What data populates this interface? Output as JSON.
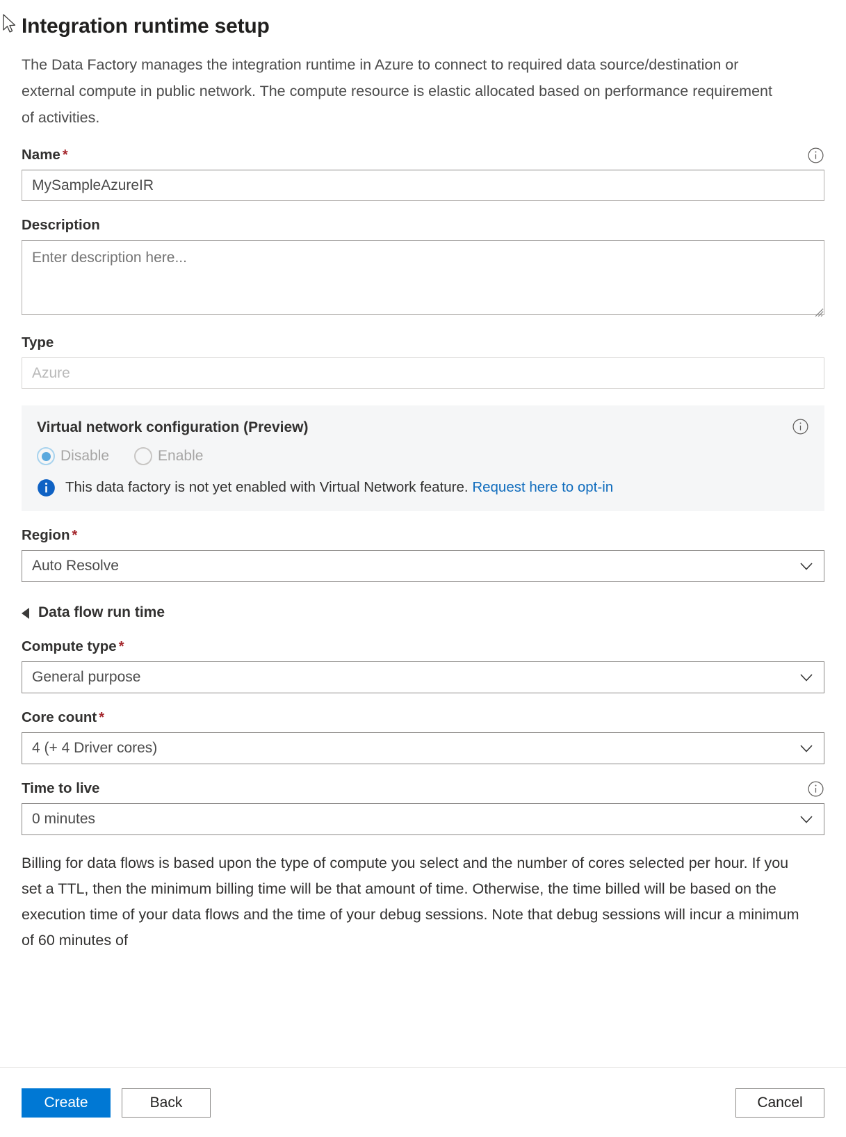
{
  "page": {
    "title": "Integration runtime setup",
    "intro": "The Data Factory manages the integration runtime in Azure to connect to required data source/destination or external compute in public network. The compute resource is elastic allocated based on performance requirement of activities."
  },
  "fields": {
    "name": {
      "label": "Name",
      "required": "*",
      "value": "MySampleAzureIR",
      "info_icon": "info-circle-icon"
    },
    "description": {
      "label": "Description",
      "placeholder": "Enter description here...",
      "value": ""
    },
    "type": {
      "label": "Type",
      "value": "Azure",
      "disabled": true
    },
    "region": {
      "label": "Region",
      "required": "*",
      "value": "Auto Resolve",
      "chevron_icon": "chevron-down-icon"
    },
    "compute_type": {
      "label": "Compute type",
      "required": "*",
      "value": "General purpose",
      "chevron_icon": "chevron-down-icon"
    },
    "core_count": {
      "label": "Core count",
      "required": "*",
      "value": "4 (+ 4 Driver cores)",
      "chevron_icon": "chevron-down-icon"
    },
    "time_to_live": {
      "label": "Time to live",
      "value": "0 minutes",
      "info_icon": "info-circle-icon",
      "chevron_icon": "chevron-down-icon"
    }
  },
  "vnet": {
    "title": "Virtual network configuration (Preview)",
    "info_icon": "info-circle-icon",
    "options": [
      {
        "label": "Disable",
        "selected": true
      },
      {
        "label": "Enable",
        "selected": false
      }
    ],
    "message": "This data factory is not yet enabled with Virtual Network feature.",
    "link_text": "Request here to opt-in",
    "message_icon": "info-filled-icon"
  },
  "dataflow_section": {
    "title": "Data flow run time",
    "expanded": true,
    "toggle_icon": "triangle-collapse-icon"
  },
  "billing_note": "Billing for data flows is based upon the type of compute you select and the number of cores selected per hour. If you set a TTL, then the minimum billing time will be that amount of time. Otherwise, the time billed will be based on the execution time of your data flows and the time of your debug sessions. Note that debug sessions will incur a minimum of 60 minutes of",
  "footer": {
    "create_label": "Create",
    "back_label": "Back",
    "cancel_label": "Cancel"
  },
  "colors": {
    "primary": "#0078d4",
    "link": "#0f6cbd",
    "required": "#a4262c",
    "panel_bg": "#f5f6f7"
  }
}
